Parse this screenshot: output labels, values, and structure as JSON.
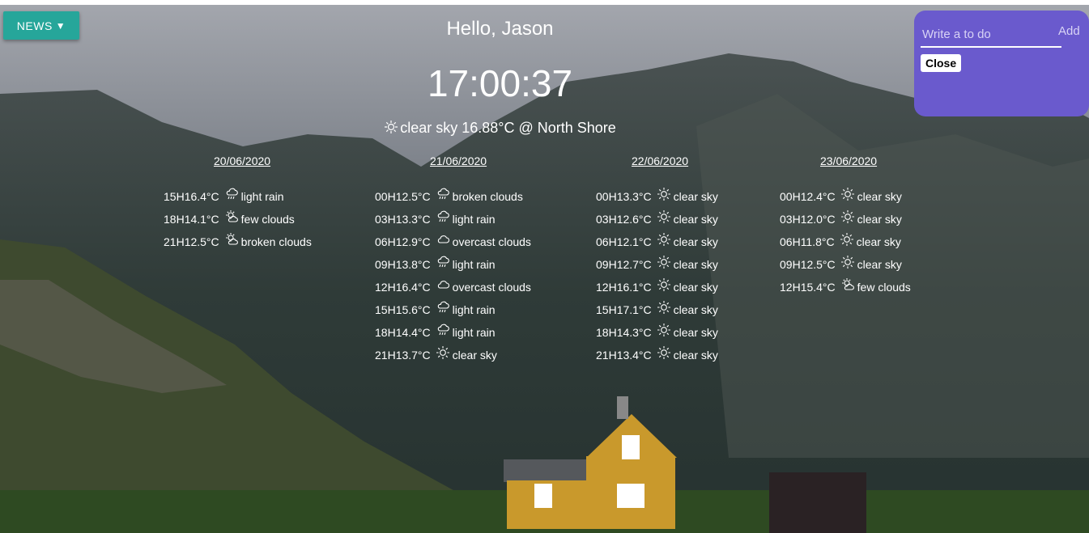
{
  "news_button": {
    "label": "NEWS",
    "arrow": "▼"
  },
  "greeting": "Hello, Jason",
  "clock": "17:00:37",
  "current_weather": {
    "icon": "sun-icon",
    "text": "clear sky 16.88°C @ North Shore"
  },
  "todo": {
    "placeholder": "Write a to do",
    "add_label": "Add",
    "close_label": "Close"
  },
  "forecast": [
    {
      "date": "20/06/2020",
      "entries": [
        {
          "time": "15H",
          "temp": "16.4°C",
          "icon": "rain-icon",
          "desc": "light rain"
        },
        {
          "time": "18H",
          "temp": "14.1°C",
          "icon": "partly-cloudy-icon",
          "desc": "few clouds"
        },
        {
          "time": "21H",
          "temp": "12.5°C",
          "icon": "partly-cloudy-icon",
          "desc": "broken clouds"
        }
      ]
    },
    {
      "date": "21/06/2020",
      "entries": [
        {
          "time": "00H",
          "temp": "12.5°C",
          "icon": "rain-icon",
          "desc": "broken clouds"
        },
        {
          "time": "03H",
          "temp": "13.3°C",
          "icon": "rain-icon",
          "desc": "light rain"
        },
        {
          "time": "06H",
          "temp": "12.9°C",
          "icon": "cloud-icon",
          "desc": "overcast clouds"
        },
        {
          "time": "09H",
          "temp": "13.8°C",
          "icon": "rain-icon",
          "desc": "light rain"
        },
        {
          "time": "12H",
          "temp": "16.4°C",
          "icon": "cloud-icon",
          "desc": "overcast clouds"
        },
        {
          "time": "15H",
          "temp": "15.6°C",
          "icon": "rain-icon",
          "desc": "light rain"
        },
        {
          "time": "18H",
          "temp": "14.4°C",
          "icon": "rain-icon",
          "desc": "light rain"
        },
        {
          "time": "21H",
          "temp": "13.7°C",
          "icon": "sun-icon",
          "desc": "clear sky"
        }
      ]
    },
    {
      "date": "22/06/2020",
      "entries": [
        {
          "time": "00H",
          "temp": "13.3°C",
          "icon": "sun-icon",
          "desc": "clear sky"
        },
        {
          "time": "03H",
          "temp": "12.6°C",
          "icon": "sun-icon",
          "desc": "clear sky"
        },
        {
          "time": "06H",
          "temp": "12.1°C",
          "icon": "sun-icon",
          "desc": "clear sky"
        },
        {
          "time": "09H",
          "temp": "12.7°C",
          "icon": "sun-icon",
          "desc": "clear sky"
        },
        {
          "time": "12H",
          "temp": "16.1°C",
          "icon": "sun-icon",
          "desc": "clear sky"
        },
        {
          "time": "15H",
          "temp": "17.1°C",
          "icon": "sun-icon",
          "desc": "clear sky"
        },
        {
          "time": "18H",
          "temp": "14.3°C",
          "icon": "sun-icon",
          "desc": "clear sky"
        },
        {
          "time": "21H",
          "temp": "13.4°C",
          "icon": "sun-icon",
          "desc": "clear sky"
        }
      ]
    },
    {
      "date": "23/06/2020",
      "entries": [
        {
          "time": "00H",
          "temp": "12.4°C",
          "icon": "sun-icon",
          "desc": "clear sky"
        },
        {
          "time": "03H",
          "temp": "12.0°C",
          "icon": "sun-icon",
          "desc": "clear sky"
        },
        {
          "time": "06H",
          "temp": "11.8°C",
          "icon": "sun-icon",
          "desc": "clear sky"
        },
        {
          "time": "09H",
          "temp": "12.5°C",
          "icon": "sun-icon",
          "desc": "clear sky"
        },
        {
          "time": "12H",
          "temp": "15.4°C",
          "icon": "partly-cloudy-icon",
          "desc": "few clouds"
        }
      ]
    }
  ]
}
